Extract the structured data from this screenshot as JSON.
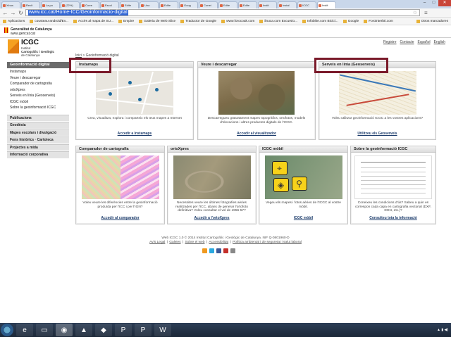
{
  "browser": {
    "tabs": [
      "Xinus",
      "Recit",
      "La po",
      "(22%)",
      "Corre",
      "Escol",
      "Edite",
      "Una",
      "Edite",
      "Goog",
      "Correi",
      "Edite",
      "Edite",
      "Instit",
      "Instal",
      "ICGC",
      "Instit"
    ],
    "address_url": "www.icc.cat/Home-ICC/Geoinformacio-digital",
    "bookmarks": [
      "Aplicacions",
      "cousteau-android/Ev...",
      "Accés al mapa de SU...",
      "Empire",
      "Galeria de Web Slice",
      "Traductor de Google",
      "www.forocoak.com",
      "ilnuca.com Excursio...",
      "Infobike.com Bicicl...",
      "Google",
      "Forointerbti.com"
    ],
    "bookmarks_other": "Otros marcadores"
  },
  "site": {
    "gencat_title": "Generalitat de Catalunya",
    "gencat_url": "www.gencat.cat",
    "logo_title": "ICGC",
    "logo_sub1": "Institut",
    "logo_sub2": "Cartogràfic i Geològic",
    "logo_sub3": "de Catalunya",
    "languages": [
      "Registre",
      "Contacte",
      "Español",
      "English"
    ],
    "breadcrumb_home": "Inici",
    "breadcrumb_sep": ">",
    "breadcrumb_current": "Geoinformació digital"
  },
  "sidebar": {
    "header": "Geoinformació digital",
    "items": [
      "Instamaps",
      "Veure i descarregar",
      "Comparador de cartografia",
      "ortoXpres",
      "Serveis en línia (Geoserveis)",
      "ICGC mòbil",
      "Sobre la geoinformació ICGC"
    ],
    "sections": [
      "Publicacions",
      "Geodèsia",
      "Mapes escolars i divulgació",
      "Fons històrics · Cartoteca",
      "Projectes a mida",
      "Informació corporativa"
    ]
  },
  "cards": [
    {
      "title": "Instamaps",
      "desc": "Crea, visualitza, explora i comparteix els teus mapes a Internet",
      "link": "Accedir a Instamaps"
    },
    {
      "title": "Veure i descarregar",
      "desc": "Descarregueu gratuïtament mapes topogràfics, ortofotos, models d'elevacions i altres productes digitals de l'ICGC.",
      "link": "Accedir al visualitzador"
    },
    {
      "title": "Serveis en línia (Geoserveis)",
      "desc": "Voleu utilitzar geoinformació ICGC a les vostres aplicacions?",
      "link": "Utilitzeu els Geoserveis"
    },
    {
      "title": "Comparador de cartografia",
      "desc": "Voleu veure les diferències entre la geoinformació produïda per l'ICC i per l'IGN?",
      "link": "Accedir al comparador"
    },
    {
      "title": "ortoXpres",
      "desc": "Necessites veure les últimes fotografies aèries realitzades per l'ICC, abans de generar l'ortofoto definitiva? Voleu consultar el vol de 1956-57?",
      "link": "Accedir a l'ortoXpres"
    },
    {
      "title": "ICGC mòbil",
      "desc": "Vegeu els mapes i fotos aèries de l'ICGC al vostre mòbil.",
      "link": "ICGC mòbil"
    },
    {
      "title": "Sobre la geoinformació ICGC",
      "desc": "Coneixeu les condicions d'ús? Sabeu a quin es correspon cada capa en cartografia vectorial (DXF, DGN, etc.)?",
      "link": "Consulteu tota la informació"
    }
  ],
  "footer": {
    "line1": "Web ICGC 1.0 © 2014 Institut Cartogràfic i Geològic de Catalunya. NIF Q-0801960-D",
    "links": [
      "Avís Legal",
      "Galeies",
      "Sobre el web",
      "Accessibilitat",
      "Política ambiental i de seguretat i salut laboral"
    ]
  },
  "colors": {
    "highlight_box": "#7a1a2a",
    "sidebar_header": "#6b6b6b",
    "logo_orange": "#f5a020"
  },
  "taskbar": {
    "apps": [
      "ie-icon",
      "folder-icon",
      "chrome-icon",
      "vlc-icon",
      "app-icon",
      "ps-icon",
      "ps2-icon",
      "word-icon"
    ]
  }
}
